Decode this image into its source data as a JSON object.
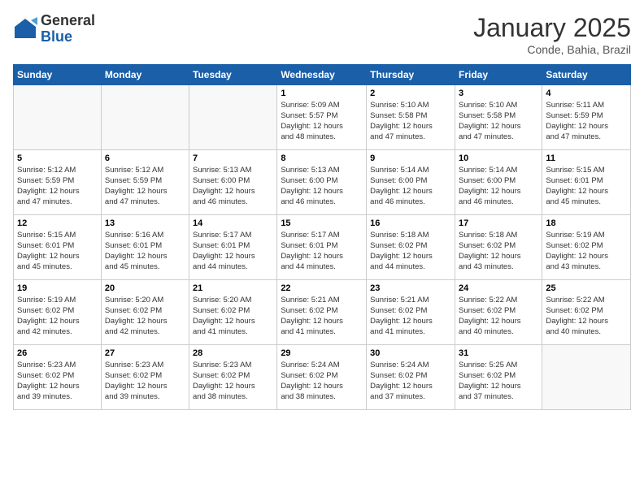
{
  "header": {
    "logo_general": "General",
    "logo_blue": "Blue",
    "month": "January 2025",
    "location": "Conde, Bahia, Brazil"
  },
  "weekdays": [
    "Sunday",
    "Monday",
    "Tuesday",
    "Wednesday",
    "Thursday",
    "Friday",
    "Saturday"
  ],
  "weeks": [
    [
      {
        "day": "",
        "text": ""
      },
      {
        "day": "",
        "text": ""
      },
      {
        "day": "",
        "text": ""
      },
      {
        "day": "1",
        "text": "Sunrise: 5:09 AM\nSunset: 5:57 PM\nDaylight: 12 hours\nand 48 minutes."
      },
      {
        "day": "2",
        "text": "Sunrise: 5:10 AM\nSunset: 5:58 PM\nDaylight: 12 hours\nand 47 minutes."
      },
      {
        "day": "3",
        "text": "Sunrise: 5:10 AM\nSunset: 5:58 PM\nDaylight: 12 hours\nand 47 minutes."
      },
      {
        "day": "4",
        "text": "Sunrise: 5:11 AM\nSunset: 5:59 PM\nDaylight: 12 hours\nand 47 minutes."
      }
    ],
    [
      {
        "day": "5",
        "text": "Sunrise: 5:12 AM\nSunset: 5:59 PM\nDaylight: 12 hours\nand 47 minutes."
      },
      {
        "day": "6",
        "text": "Sunrise: 5:12 AM\nSunset: 5:59 PM\nDaylight: 12 hours\nand 47 minutes."
      },
      {
        "day": "7",
        "text": "Sunrise: 5:13 AM\nSunset: 6:00 PM\nDaylight: 12 hours\nand 46 minutes."
      },
      {
        "day": "8",
        "text": "Sunrise: 5:13 AM\nSunset: 6:00 PM\nDaylight: 12 hours\nand 46 minutes."
      },
      {
        "day": "9",
        "text": "Sunrise: 5:14 AM\nSunset: 6:00 PM\nDaylight: 12 hours\nand 46 minutes."
      },
      {
        "day": "10",
        "text": "Sunrise: 5:14 AM\nSunset: 6:00 PM\nDaylight: 12 hours\nand 46 minutes."
      },
      {
        "day": "11",
        "text": "Sunrise: 5:15 AM\nSunset: 6:01 PM\nDaylight: 12 hours\nand 45 minutes."
      }
    ],
    [
      {
        "day": "12",
        "text": "Sunrise: 5:15 AM\nSunset: 6:01 PM\nDaylight: 12 hours\nand 45 minutes."
      },
      {
        "day": "13",
        "text": "Sunrise: 5:16 AM\nSunset: 6:01 PM\nDaylight: 12 hours\nand 45 minutes."
      },
      {
        "day": "14",
        "text": "Sunrise: 5:17 AM\nSunset: 6:01 PM\nDaylight: 12 hours\nand 44 minutes."
      },
      {
        "day": "15",
        "text": "Sunrise: 5:17 AM\nSunset: 6:01 PM\nDaylight: 12 hours\nand 44 minutes."
      },
      {
        "day": "16",
        "text": "Sunrise: 5:18 AM\nSunset: 6:02 PM\nDaylight: 12 hours\nand 44 minutes."
      },
      {
        "day": "17",
        "text": "Sunrise: 5:18 AM\nSunset: 6:02 PM\nDaylight: 12 hours\nand 43 minutes."
      },
      {
        "day": "18",
        "text": "Sunrise: 5:19 AM\nSunset: 6:02 PM\nDaylight: 12 hours\nand 43 minutes."
      }
    ],
    [
      {
        "day": "19",
        "text": "Sunrise: 5:19 AM\nSunset: 6:02 PM\nDaylight: 12 hours\nand 42 minutes."
      },
      {
        "day": "20",
        "text": "Sunrise: 5:20 AM\nSunset: 6:02 PM\nDaylight: 12 hours\nand 42 minutes."
      },
      {
        "day": "21",
        "text": "Sunrise: 5:20 AM\nSunset: 6:02 PM\nDaylight: 12 hours\nand 41 minutes."
      },
      {
        "day": "22",
        "text": "Sunrise: 5:21 AM\nSunset: 6:02 PM\nDaylight: 12 hours\nand 41 minutes."
      },
      {
        "day": "23",
        "text": "Sunrise: 5:21 AM\nSunset: 6:02 PM\nDaylight: 12 hours\nand 41 minutes."
      },
      {
        "day": "24",
        "text": "Sunrise: 5:22 AM\nSunset: 6:02 PM\nDaylight: 12 hours\nand 40 minutes."
      },
      {
        "day": "25",
        "text": "Sunrise: 5:22 AM\nSunset: 6:02 PM\nDaylight: 12 hours\nand 40 minutes."
      }
    ],
    [
      {
        "day": "26",
        "text": "Sunrise: 5:23 AM\nSunset: 6:02 PM\nDaylight: 12 hours\nand 39 minutes."
      },
      {
        "day": "27",
        "text": "Sunrise: 5:23 AM\nSunset: 6:02 PM\nDaylight: 12 hours\nand 39 minutes."
      },
      {
        "day": "28",
        "text": "Sunrise: 5:23 AM\nSunset: 6:02 PM\nDaylight: 12 hours\nand 38 minutes."
      },
      {
        "day": "29",
        "text": "Sunrise: 5:24 AM\nSunset: 6:02 PM\nDaylight: 12 hours\nand 38 minutes."
      },
      {
        "day": "30",
        "text": "Sunrise: 5:24 AM\nSunset: 6:02 PM\nDaylight: 12 hours\nand 37 minutes."
      },
      {
        "day": "31",
        "text": "Sunrise: 5:25 AM\nSunset: 6:02 PM\nDaylight: 12 hours\nand 37 minutes."
      },
      {
        "day": "",
        "text": ""
      }
    ]
  ]
}
